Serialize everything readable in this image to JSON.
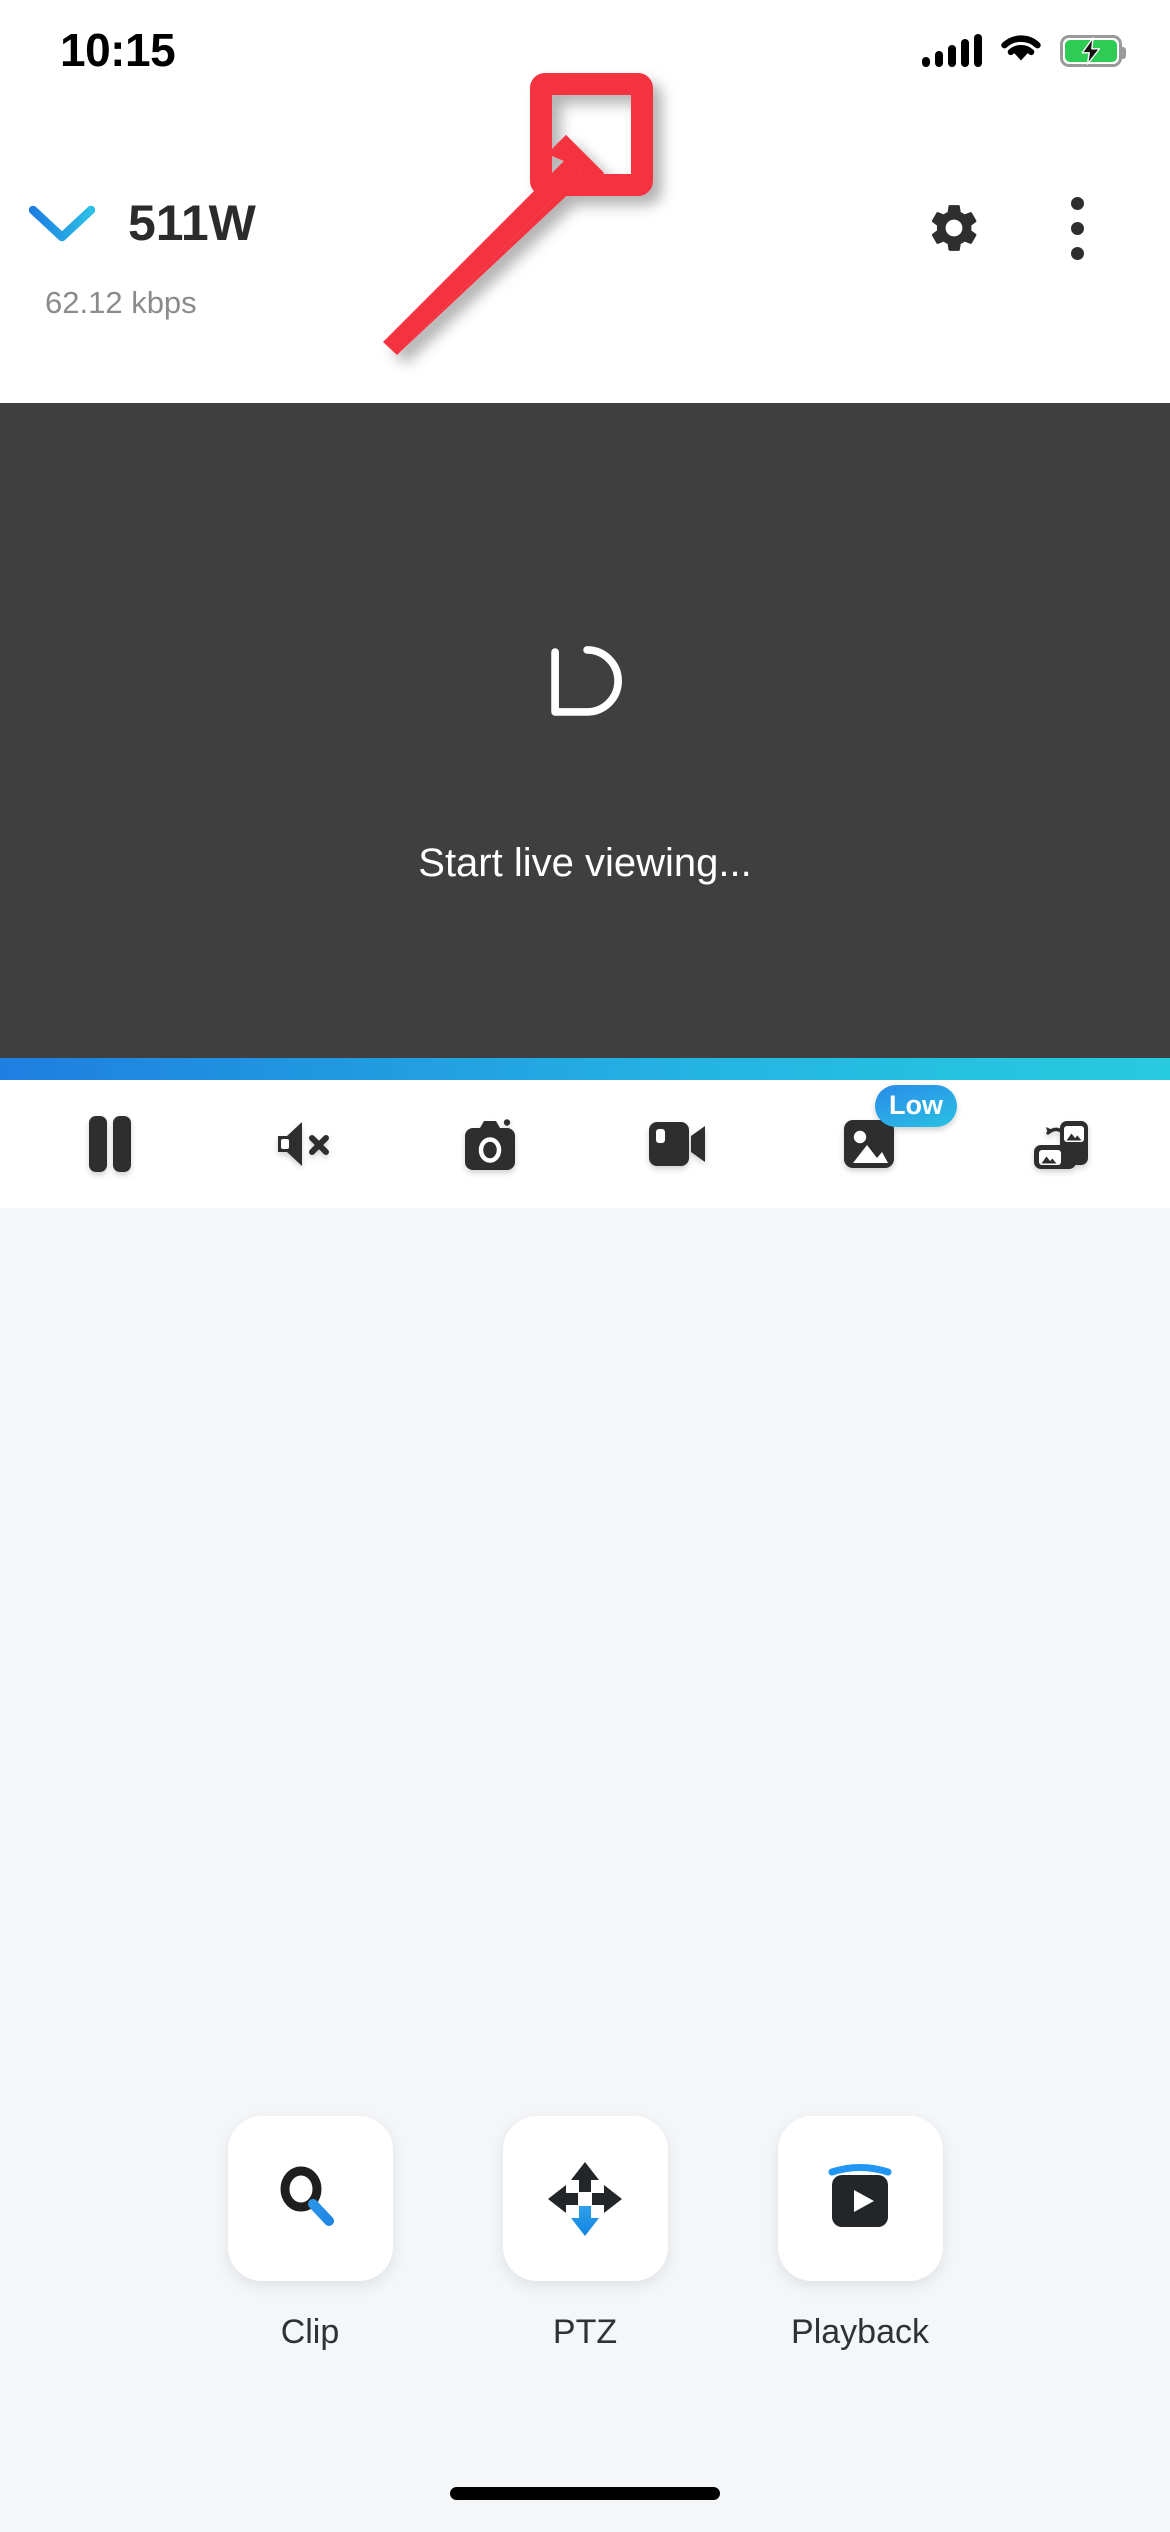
{
  "status_bar": {
    "time": "10:15",
    "signal_icon": "cellular-signal-icon",
    "wifi_icon": "wifi-icon",
    "battery_icon": "battery-charging-icon",
    "battery_charging": true,
    "battery_color": "#2ECC54"
  },
  "header": {
    "chevron_icon": "chevron-down-icon",
    "camera_name": "511W",
    "bitrate": "62.12 kbps",
    "settings_icon": "gear-icon",
    "more_icon": "more-vertical-icon",
    "orientation_icon": "screen-orientation-icon"
  },
  "annotation": {
    "highlight_color": "#F5333F",
    "target": "gear-icon",
    "shape": "rectangle-with-arrow"
  },
  "video": {
    "status_text": "Start live viewing...",
    "spinner_icon": "loading-spinner-icon",
    "background_color": "#3F3F3F",
    "accent_gradient_from": "#1E7FE0",
    "accent_gradient_to": "#27CBE0"
  },
  "toolbar": {
    "items": [
      {
        "name": "pause-button",
        "icon": "pause-icon",
        "badge": null
      },
      {
        "name": "mute-button",
        "icon": "speaker-mute-icon",
        "badge": null
      },
      {
        "name": "snapshot-button",
        "icon": "camera-icon",
        "badge": null
      },
      {
        "name": "record-button",
        "icon": "video-camera-icon",
        "badge": null
      },
      {
        "name": "quality-button",
        "icon": "image-quality-icon",
        "badge": "Low"
      },
      {
        "name": "layout-button",
        "icon": "rotate-layout-icon",
        "badge": null
      }
    ]
  },
  "actions": [
    {
      "label": "Clip",
      "icon": "magnifier-icon"
    },
    {
      "label": "PTZ",
      "icon": "pan-tilt-zoom-icon"
    },
    {
      "label": "Playback",
      "icon": "playback-play-icon"
    }
  ],
  "system": {
    "home_indicator": "home-indicator"
  }
}
